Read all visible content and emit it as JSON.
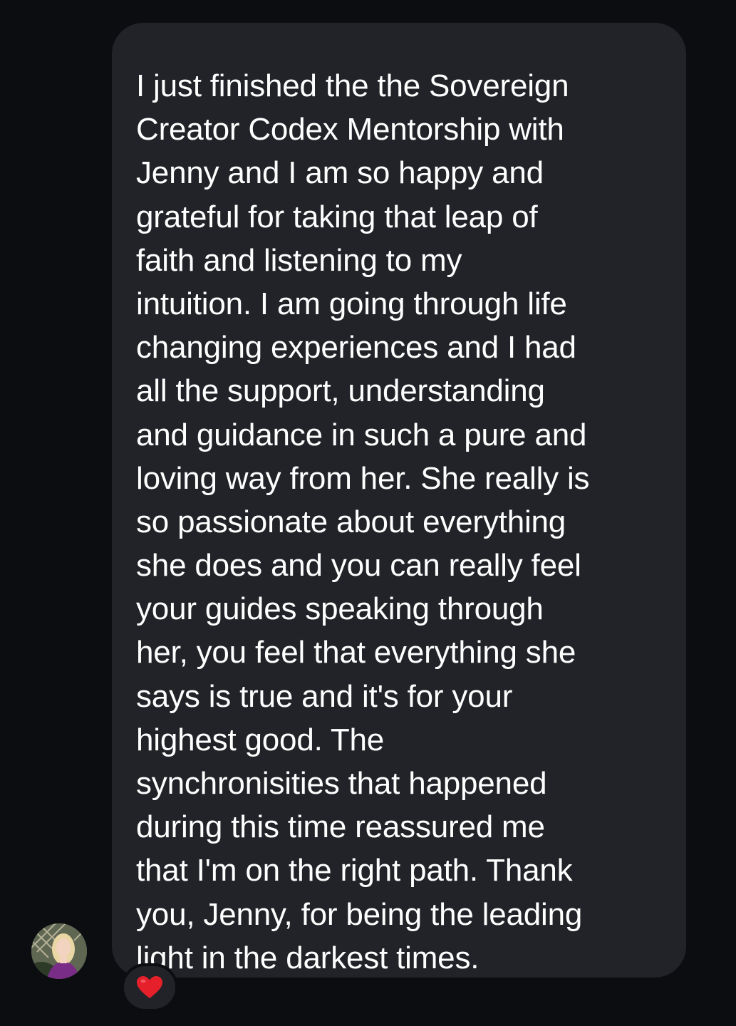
{
  "message": {
    "lines": [
      "I just finished the the Sovereign",
      "Creator Codex Mentorship with",
      "Jenny and I am so happy and",
      "grateful for taking that leap of",
      "faith and listening to my",
      "intuition. I am going through life",
      "changing experiences and I had",
      "all the support, understanding",
      "and guidance in such a pure and",
      "loving way from her. She really is",
      "so passionate about everything",
      "she does and you can really feel",
      "your guides speaking through",
      "her, you feel that everything she",
      "says is true and it's for your",
      "highest good. The",
      "synchronisities that happened",
      "during this time reassured me",
      "that I'm on the right path. Thank",
      "you, Jenny, for being the leading",
      "light in the darkest times."
    ]
  },
  "avatar": {
    "icon": "user-avatar-photo"
  },
  "reaction": {
    "icon": "red-heart-icon",
    "color": "#e5202b"
  },
  "colors": {
    "background": "#0b0d11",
    "bubble": "#212328",
    "text": "#ffffff"
  }
}
